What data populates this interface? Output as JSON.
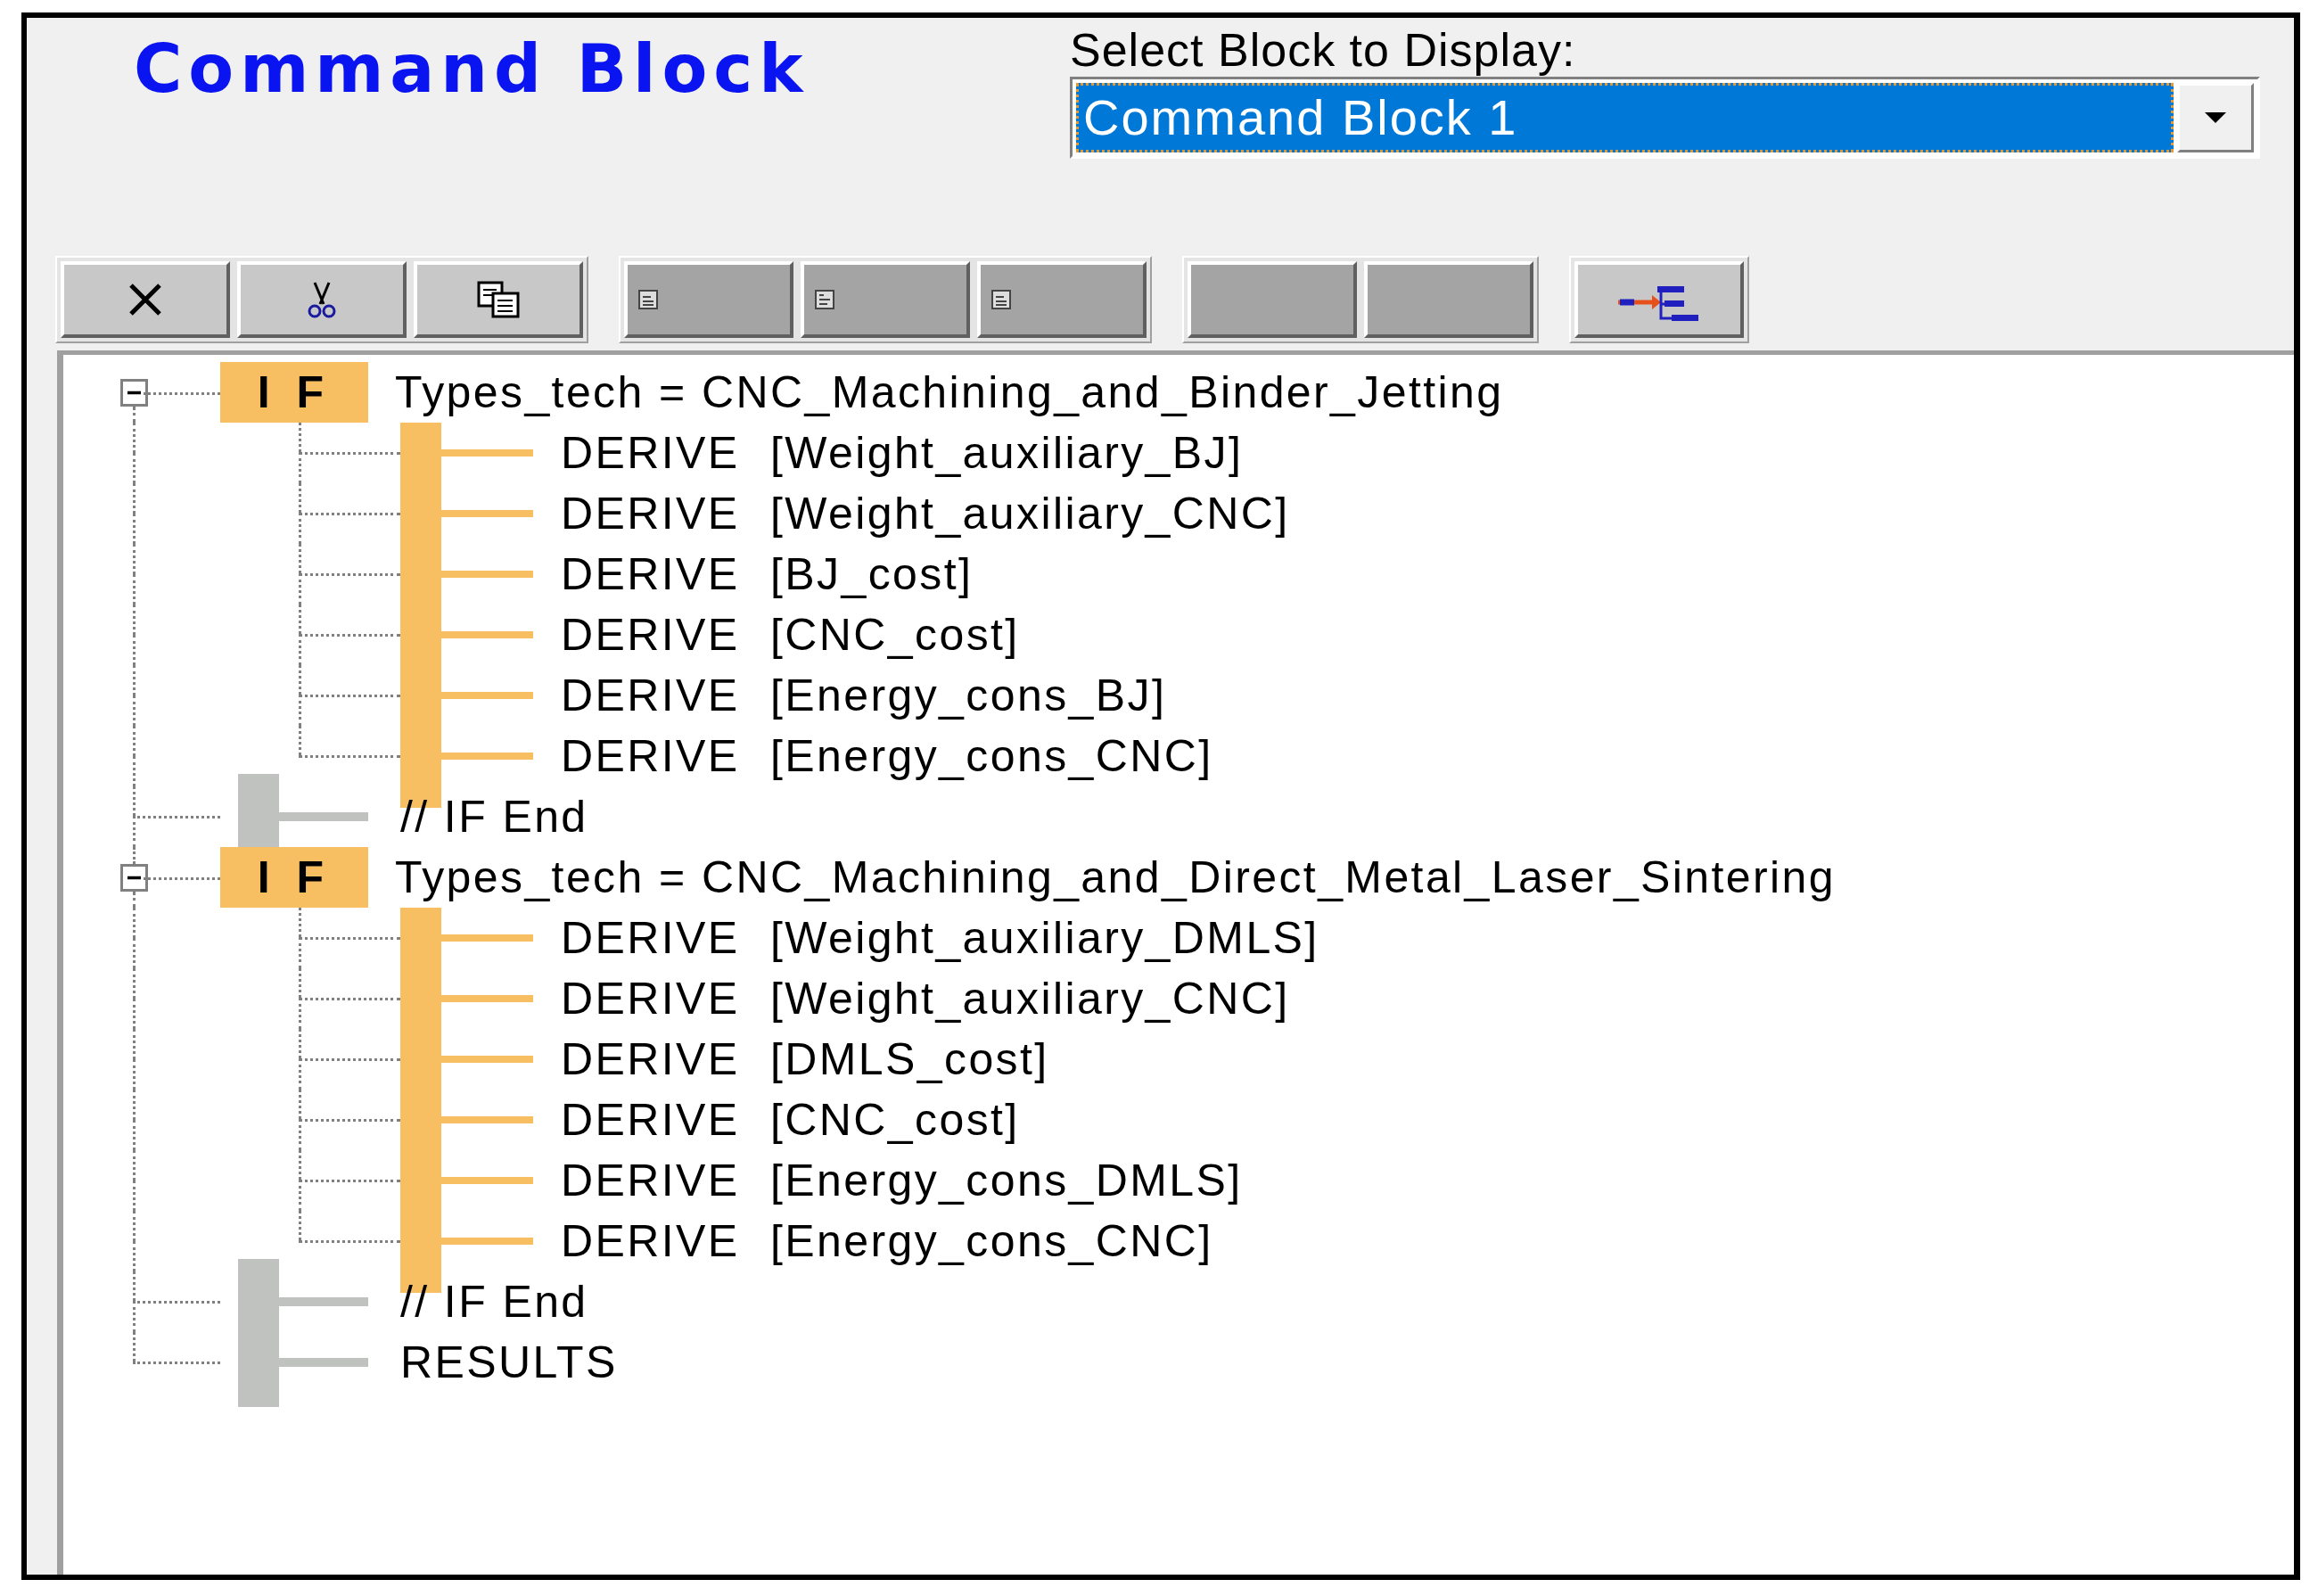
{
  "header": {
    "title": "Command Block",
    "select_label": "Select Block to Display:",
    "select_value": "Command Block 1"
  },
  "toolbar": [
    [
      {
        "kind": "delete",
        "disabled": false
      },
      {
        "kind": "cut",
        "disabled": false
      },
      {
        "kind": "copy",
        "disabled": false
      }
    ],
    [
      {
        "kind": "doc-low",
        "disabled": true
      },
      {
        "kind": "doc-high",
        "disabled": true
      },
      {
        "kind": "doc-low",
        "disabled": true
      }
    ],
    [
      {
        "kind": "blank",
        "disabled": true
      },
      {
        "kind": "blank",
        "disabled": true
      }
    ],
    [
      {
        "kind": "tree",
        "disabled": false
      }
    ]
  ],
  "tree": [
    {
      "kind": "if",
      "keyword": "I F",
      "text": "Types_tech = CNC_Machining_and_Binder_Jetting",
      "expanded": true,
      "children": [
        {
          "kind": "derive",
          "keyword": "DERIVE",
          "text": "[Weight_auxiliary_BJ]"
        },
        {
          "kind": "derive",
          "keyword": "DERIVE",
          "text": "[Weight_auxiliary_CNC]"
        },
        {
          "kind": "derive",
          "keyword": "DERIVE",
          "text": "[BJ_cost]"
        },
        {
          "kind": "derive",
          "keyword": "DERIVE",
          "text": "[CNC_cost]"
        },
        {
          "kind": "derive",
          "keyword": "DERIVE",
          "text": "[Energy_cons_BJ]"
        },
        {
          "kind": "derive",
          "keyword": "DERIVE",
          "text": "[Energy_cons_CNC]"
        }
      ]
    },
    {
      "kind": "end",
      "text": "// IF End"
    },
    {
      "kind": "if",
      "keyword": "I F",
      "text": "Types_tech = CNC_Machining_and_Direct_Metal_Laser_Sintering",
      "expanded": true,
      "children": [
        {
          "kind": "derive",
          "keyword": "DERIVE",
          "text": "[Weight_auxiliary_DMLS]"
        },
        {
          "kind": "derive",
          "keyword": "DERIVE",
          "text": "[Weight_auxiliary_CNC]"
        },
        {
          "kind": "derive",
          "keyword": "DERIVE",
          "text": "[DMLS_cost]"
        },
        {
          "kind": "derive",
          "keyword": "DERIVE",
          "text": "[CNC_cost]"
        },
        {
          "kind": "derive",
          "keyword": "DERIVE",
          "text": "[Energy_cons_DMLS]"
        },
        {
          "kind": "derive",
          "keyword": "DERIVE",
          "text": "[Energy_cons_CNC]"
        }
      ]
    },
    {
      "kind": "end",
      "text": "// IF End"
    },
    {
      "kind": "end",
      "text": "RESULTS"
    }
  ]
}
